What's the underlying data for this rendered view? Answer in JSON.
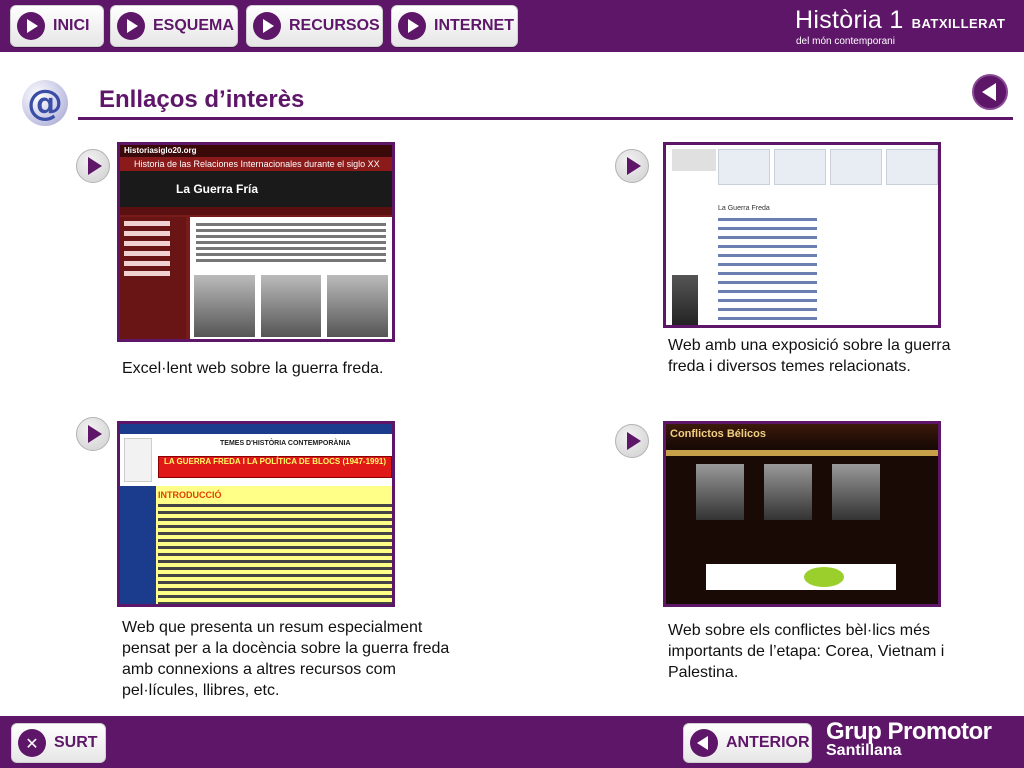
{
  "nav": [
    {
      "label": "INICI",
      "icon": "play-icon"
    },
    {
      "label": "ESQUEMA",
      "icon": "play-icon"
    },
    {
      "label": "RECURSOS",
      "icon": "play-icon"
    },
    {
      "label": "INTERNET",
      "icon": "play-icon"
    }
  ],
  "brand": {
    "title": "Història 1",
    "level": "BATXILLERAT",
    "subtitle": "del món contemporani"
  },
  "page": {
    "title": "Enllaços d’interès",
    "icon": "at-sign-icon"
  },
  "links": [
    {
      "thumb_header": "Historiasiglo20.org",
      "thumb_subtitle": "Historia de las Relaciones Internacionales durante el siglo XX",
      "thumb_banner": "La Guerra Fría",
      "description": "Excel·lent web sobre la guerra freda."
    },
    {
      "thumb_title": "La Guerra Freda",
      "description": "Web amb una exposició sobre la guerra freda i diversos temes relacionats."
    },
    {
      "thumb_header": "TEMES D'HISTÒRIA CONTEMPORÀNIA",
      "thumb_banner": "LA GUERRA FREDA I LA POLÍTICA DE BLOCS (1947-1991)",
      "thumb_section": "INTRODUCCIÓ",
      "description": "Web que presenta un resum especialment pensat per a la docència sobre la guerra freda amb connexions a altres recursos com pel·lícules, llibres, etc."
    },
    {
      "thumb_header": "Conflictos Bélicos",
      "description": "Web sobre els conflictes bèl·lics més importants de l’etapa: Corea, Vietnam i Palestina."
    }
  ],
  "footer": {
    "exit_label": "SURT",
    "back_label": "ANTERIOR",
    "publisher_line1": "Grup Promotor",
    "publisher_line2": "Santillana"
  },
  "colors": {
    "brand_purple": "#5e1669",
    "white": "#ffffff"
  }
}
